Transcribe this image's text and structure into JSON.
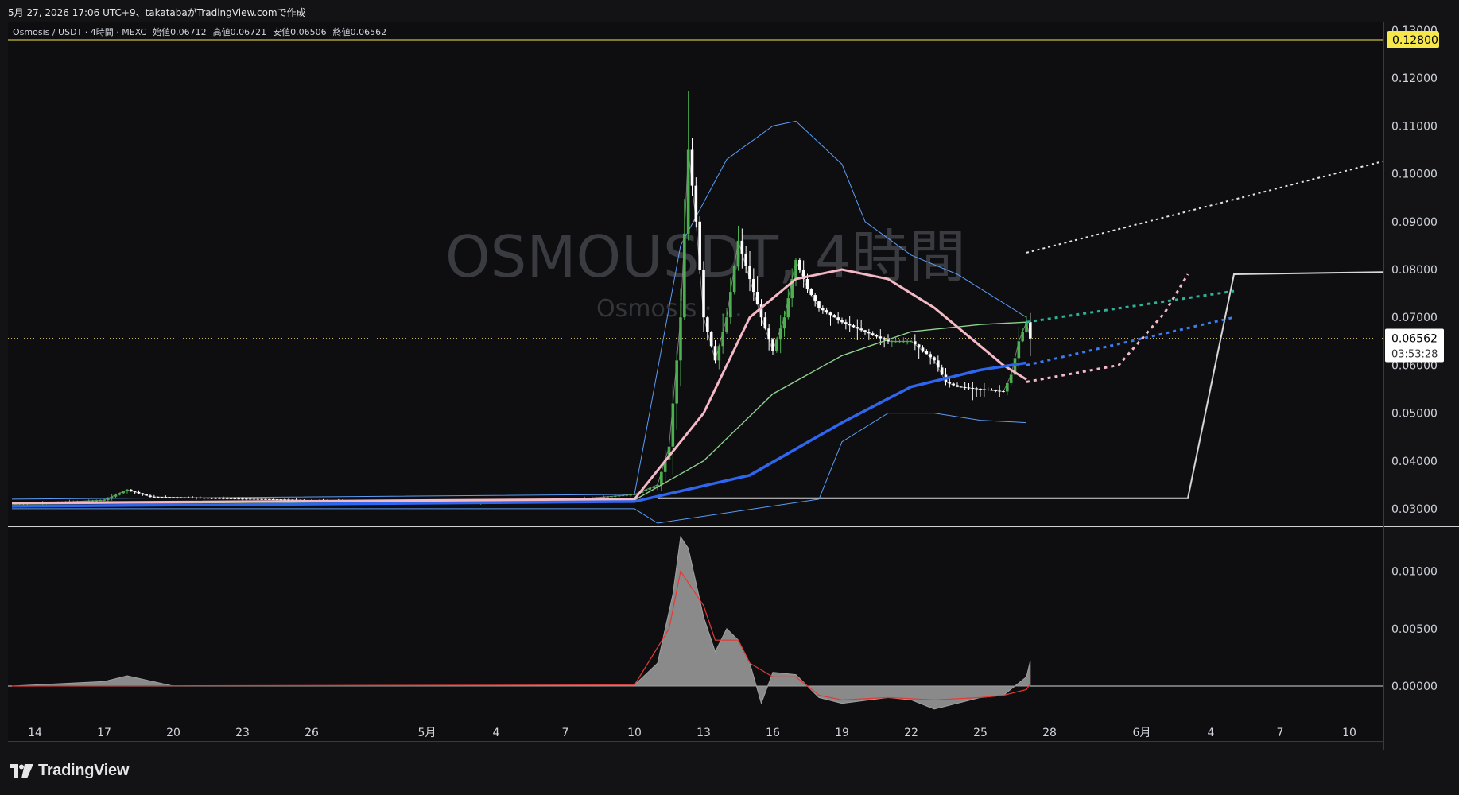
{
  "header": {
    "caption": "5月 27, 2026 17:06 UTC+9、takatabaがTradingView.comで作成"
  },
  "legend": {
    "symbol": "Osmosis / USDT · 4時間 · MEXC",
    "open_label": "始値",
    "open": "0.06712",
    "high_label": "高値",
    "high": "0.06721",
    "low_label": "安値",
    "low": "0.06506",
    "close_label": "終値",
    "close": "0.06562"
  },
  "watermark": {
    "main": "OSMOUSDT, 4時間",
    "sub": "Osmosis · ..."
  },
  "price_axis": {
    "ticks": [
      "0.12000",
      "0.11000",
      "0.10000",
      "0.09000",
      "0.08000",
      "0.07000",
      "0.06000",
      "0.05000",
      "0.04000",
      "0.03000"
    ],
    "top_partial": "0.13000",
    "alert_label": "0.12800",
    "current_price": "0.06562",
    "countdown": "03:53:28"
  },
  "osc_axis": {
    "ticks": [
      "0.01000",
      "0.00500",
      "0.00000"
    ]
  },
  "time_axis": {
    "labels": [
      "14",
      "17",
      "20",
      "23",
      "26",
      "5月",
      "4",
      "7",
      "10",
      "13",
      "16",
      "19",
      "22",
      "25",
      "28",
      "6月",
      "4",
      "7",
      "10"
    ]
  },
  "footer": {
    "brand": "TradingView"
  },
  "colors": {
    "background": "#0e0e10",
    "up": "#4caf50",
    "down": "#ffffff",
    "bb": "#5b9cf6",
    "ema_pink": "#f4b8c6",
    "ema_green": "#8fd18f",
    "ema_blue": "#2f66f0",
    "ma_violet": "#b070d8",
    "alert": "#f6e84a",
    "osc_fill": "#8a8a8a",
    "osc_signal": "#e53935"
  },
  "chart_data": [
    {
      "type": "candlestick",
      "title": "Osmosis / USDT · 4時間 · MEXC",
      "ylim": [
        0.027,
        0.131
      ],
      "x_domain": [
        "2026-04-13",
        "2026-06-13"
      ],
      "ohlc_last": {
        "open": 0.06712,
        "high": 0.06721,
        "low": 0.06506,
        "close": 0.06562
      },
      "horizontal_lines": [
        {
          "label": "0.12800",
          "value": 0.128
        }
      ],
      "price_path": [
        [
          "2026-04-13",
          0.031
        ],
        [
          "2026-04-17",
          0.0318
        ],
        [
          "2026-04-18",
          0.034
        ],
        [
          "2026-04-19",
          0.0325
        ],
        [
          "2026-04-24",
          0.032
        ],
        [
          "2026-04-28",
          0.0315
        ],
        [
          "2026-05-03",
          0.0312
        ],
        [
          "2026-05-07",
          0.0318
        ],
        [
          "2026-05-10",
          0.033
        ],
        [
          "2026-05-11",
          0.035
        ],
        [
          "2026-05-11T12",
          0.043
        ],
        [
          "2026-05-12",
          0.07
        ],
        [
          "2026-05-12T08",
          0.105
        ],
        [
          "2026-05-12T16",
          0.09
        ],
        [
          "2026-05-13",
          0.07
        ],
        [
          "2026-05-13T12",
          0.061
        ],
        [
          "2026-05-14",
          0.07
        ],
        [
          "2026-05-14T12",
          0.086
        ],
        [
          "2026-05-15",
          0.078
        ],
        [
          "2026-05-15T12",
          0.07
        ],
        [
          "2026-05-16",
          0.063
        ],
        [
          "2026-05-16T12",
          0.07
        ],
        [
          "2026-05-17",
          0.082
        ],
        [
          "2026-05-17T12",
          0.076
        ],
        [
          "2026-05-18",
          0.072
        ],
        [
          "2026-05-19",
          0.069
        ],
        [
          "2026-05-20",
          0.067
        ],
        [
          "2026-05-21",
          0.065
        ],
        [
          "2026-05-22",
          0.065
        ],
        [
          "2026-05-23",
          0.061
        ],
        [
          "2026-05-23T12",
          0.0565
        ],
        [
          "2026-05-24",
          0.0555
        ],
        [
          "2026-05-25",
          0.055
        ],
        [
          "2026-05-26",
          0.0545
        ],
        [
          "2026-05-26T08",
          0.058
        ],
        [
          "2026-05-26T16",
          0.065
        ],
        [
          "2026-05-27",
          0.069
        ],
        [
          "2026-05-27T04",
          0.0656
        ]
      ],
      "indicators": {
        "ema_blue": [
          [
            "2026-04-13",
            0.0305
          ],
          [
            "2026-05-10",
            0.0315
          ],
          [
            "2026-05-15",
            0.037
          ],
          [
            "2026-05-19",
            0.048
          ],
          [
            "2026-05-22",
            0.0555
          ],
          [
            "2026-05-25",
            0.059
          ],
          [
            "2026-05-27",
            0.0605
          ]
        ],
        "ema_green": [
          [
            "2026-04-13",
            0.031
          ],
          [
            "2026-05-10",
            0.0318
          ],
          [
            "2026-05-13",
            0.04
          ],
          [
            "2026-05-16",
            0.054
          ],
          [
            "2026-05-19",
            0.062
          ],
          [
            "2026-05-22",
            0.067
          ],
          [
            "2026-05-25",
            0.0685
          ],
          [
            "2026-05-27",
            0.069
          ]
        ],
        "ema_pink": [
          [
            "2026-04-13",
            0.0312
          ],
          [
            "2026-05-10",
            0.032
          ],
          [
            "2026-05-13",
            0.05
          ],
          [
            "2026-05-15",
            0.07
          ],
          [
            "2026-05-17",
            0.078
          ],
          [
            "2026-05-19",
            0.08
          ],
          [
            "2026-05-21",
            0.078
          ],
          [
            "2026-05-23",
            0.072
          ],
          [
            "2026-05-25",
            0.064
          ],
          [
            "2026-05-26",
            0.06
          ],
          [
            "2026-05-27",
            0.057
          ]
        ],
        "bb_upper": [
          [
            "2026-04-13",
            0.032
          ],
          [
            "2026-05-10",
            0.033
          ],
          [
            "2026-05-12",
            0.085
          ],
          [
            "2026-05-14",
            0.103
          ],
          [
            "2026-05-16",
            0.11
          ],
          [
            "2026-05-17",
            0.111
          ],
          [
            "2026-05-19",
            0.102
          ],
          [
            "2026-05-20",
            0.09
          ],
          [
            "2026-05-22",
            0.083
          ],
          [
            "2026-05-24",
            0.079
          ],
          [
            "2026-05-26",
            0.073
          ],
          [
            "2026-05-27",
            0.07
          ]
        ],
        "bb_lower": [
          [
            "2026-04-13",
            0.03
          ],
          [
            "2026-05-10",
            0.03
          ],
          [
            "2026-05-11",
            0.027
          ],
          [
            "2026-05-18",
            0.032
          ],
          [
            "2026-05-19",
            0.044
          ],
          [
            "2026-05-21",
            0.05
          ],
          [
            "2026-05-23",
            0.05
          ],
          [
            "2026-05-25",
            0.0485
          ],
          [
            "2026-05-27",
            0.048
          ]
        ],
        "forecast_white_dotted": [
          [
            "2026-05-27",
            0.0835
          ],
          [
            "2026-06-13",
            0.1045
          ]
        ],
        "forecast_teal_dotted": [
          [
            "2026-05-27",
            0.069
          ],
          [
            "2026-06-05",
            0.0755
          ]
        ],
        "forecast_blue_dotted": [
          [
            "2026-05-27",
            0.06
          ],
          [
            "2026-06-05",
            0.07
          ]
        ],
        "forecast_pink_dotted": [
          [
            "2026-05-27",
            0.0565
          ],
          [
            "2026-05-31",
            0.06
          ],
          [
            "2026-06-02",
            0.071
          ],
          [
            "2026-06-03",
            0.079
          ]
        ],
        "projection_white": [
          [
            "2026-05-11",
            0.0322
          ],
          [
            "2026-06-03",
            0.0322
          ],
          [
            "2026-06-05",
            0.079
          ],
          [
            "2026-06-12",
            0.0795
          ],
          [
            "2026-06-13",
            0.0805
          ]
        ]
      }
    },
    {
      "type": "area",
      "title": "oscillator",
      "ylim": [
        -0.0045,
        0.0135
      ],
      "series": [
        {
          "name": "",
          "values": [
            [
              "2026-04-13",
              0.0
            ],
            [
              "2026-04-17",
              0.0004
            ],
            [
              "2026-04-18",
              0.0009
            ],
            [
              "2026-04-20",
              0.0
            ],
            [
              "2026-05-10",
              0.0001
            ],
            [
              "2026-05-11",
              0.002
            ],
            [
              "2026-05-11T16",
              0.008
            ],
            [
              "2026-05-12",
              0.013
            ],
            [
              "2026-05-12T08",
              0.012
            ],
            [
              "2026-05-13",
              0.006
            ],
            [
              "2026-05-13T12",
              0.003
            ],
            [
              "2026-05-14",
              0.005
            ],
            [
              "2026-05-14T12",
              0.004
            ],
            [
              "2026-05-15",
              0.002
            ],
            [
              "2026-05-15T12",
              -0.0015
            ],
            [
              "2026-05-16",
              0.0012
            ],
            [
              "2026-05-17",
              0.001
            ],
            [
              "2026-05-18",
              -0.001
            ],
            [
              "2026-05-19",
              -0.0015
            ],
            [
              "2026-05-21",
              -0.001
            ],
            [
              "2026-05-22",
              -0.0012
            ],
            [
              "2026-05-23",
              -0.002
            ],
            [
              "2026-05-24",
              -0.0015
            ],
            [
              "2026-05-25",
              -0.001
            ],
            [
              "2026-05-26",
              -0.0008
            ],
            [
              "2026-05-27",
              0.0008
            ],
            [
              "2026-05-27T04",
              0.0022
            ]
          ]
        },
        {
          "name": "",
          "values": [
            [
              "2026-04-13",
              0.0
            ],
            [
              "2026-05-10",
              0.0001
            ],
            [
              "2026-05-11T12",
              0.005
            ],
            [
              "2026-05-12",
              0.01
            ],
            [
              "2026-05-13",
              0.007
            ],
            [
              "2026-05-13T12",
              0.004
            ],
            [
              "2026-05-14T12",
              0.004
            ],
            [
              "2026-05-15",
              0.002
            ],
            [
              "2026-05-16",
              0.0008
            ],
            [
              "2026-05-17",
              0.0008
            ],
            [
              "2026-05-18",
              -0.0008
            ],
            [
              "2026-05-19",
              -0.0012
            ],
            [
              "2026-05-21",
              -0.001
            ],
            [
              "2026-05-23",
              -0.0012
            ],
            [
              "2026-05-25",
              -0.001
            ],
            [
              "2026-05-26",
              -0.0008
            ],
            [
              "2026-05-27",
              -0.0003
            ],
            [
              "2026-05-27T04",
              0.0002
            ]
          ]
        }
      ]
    }
  ]
}
